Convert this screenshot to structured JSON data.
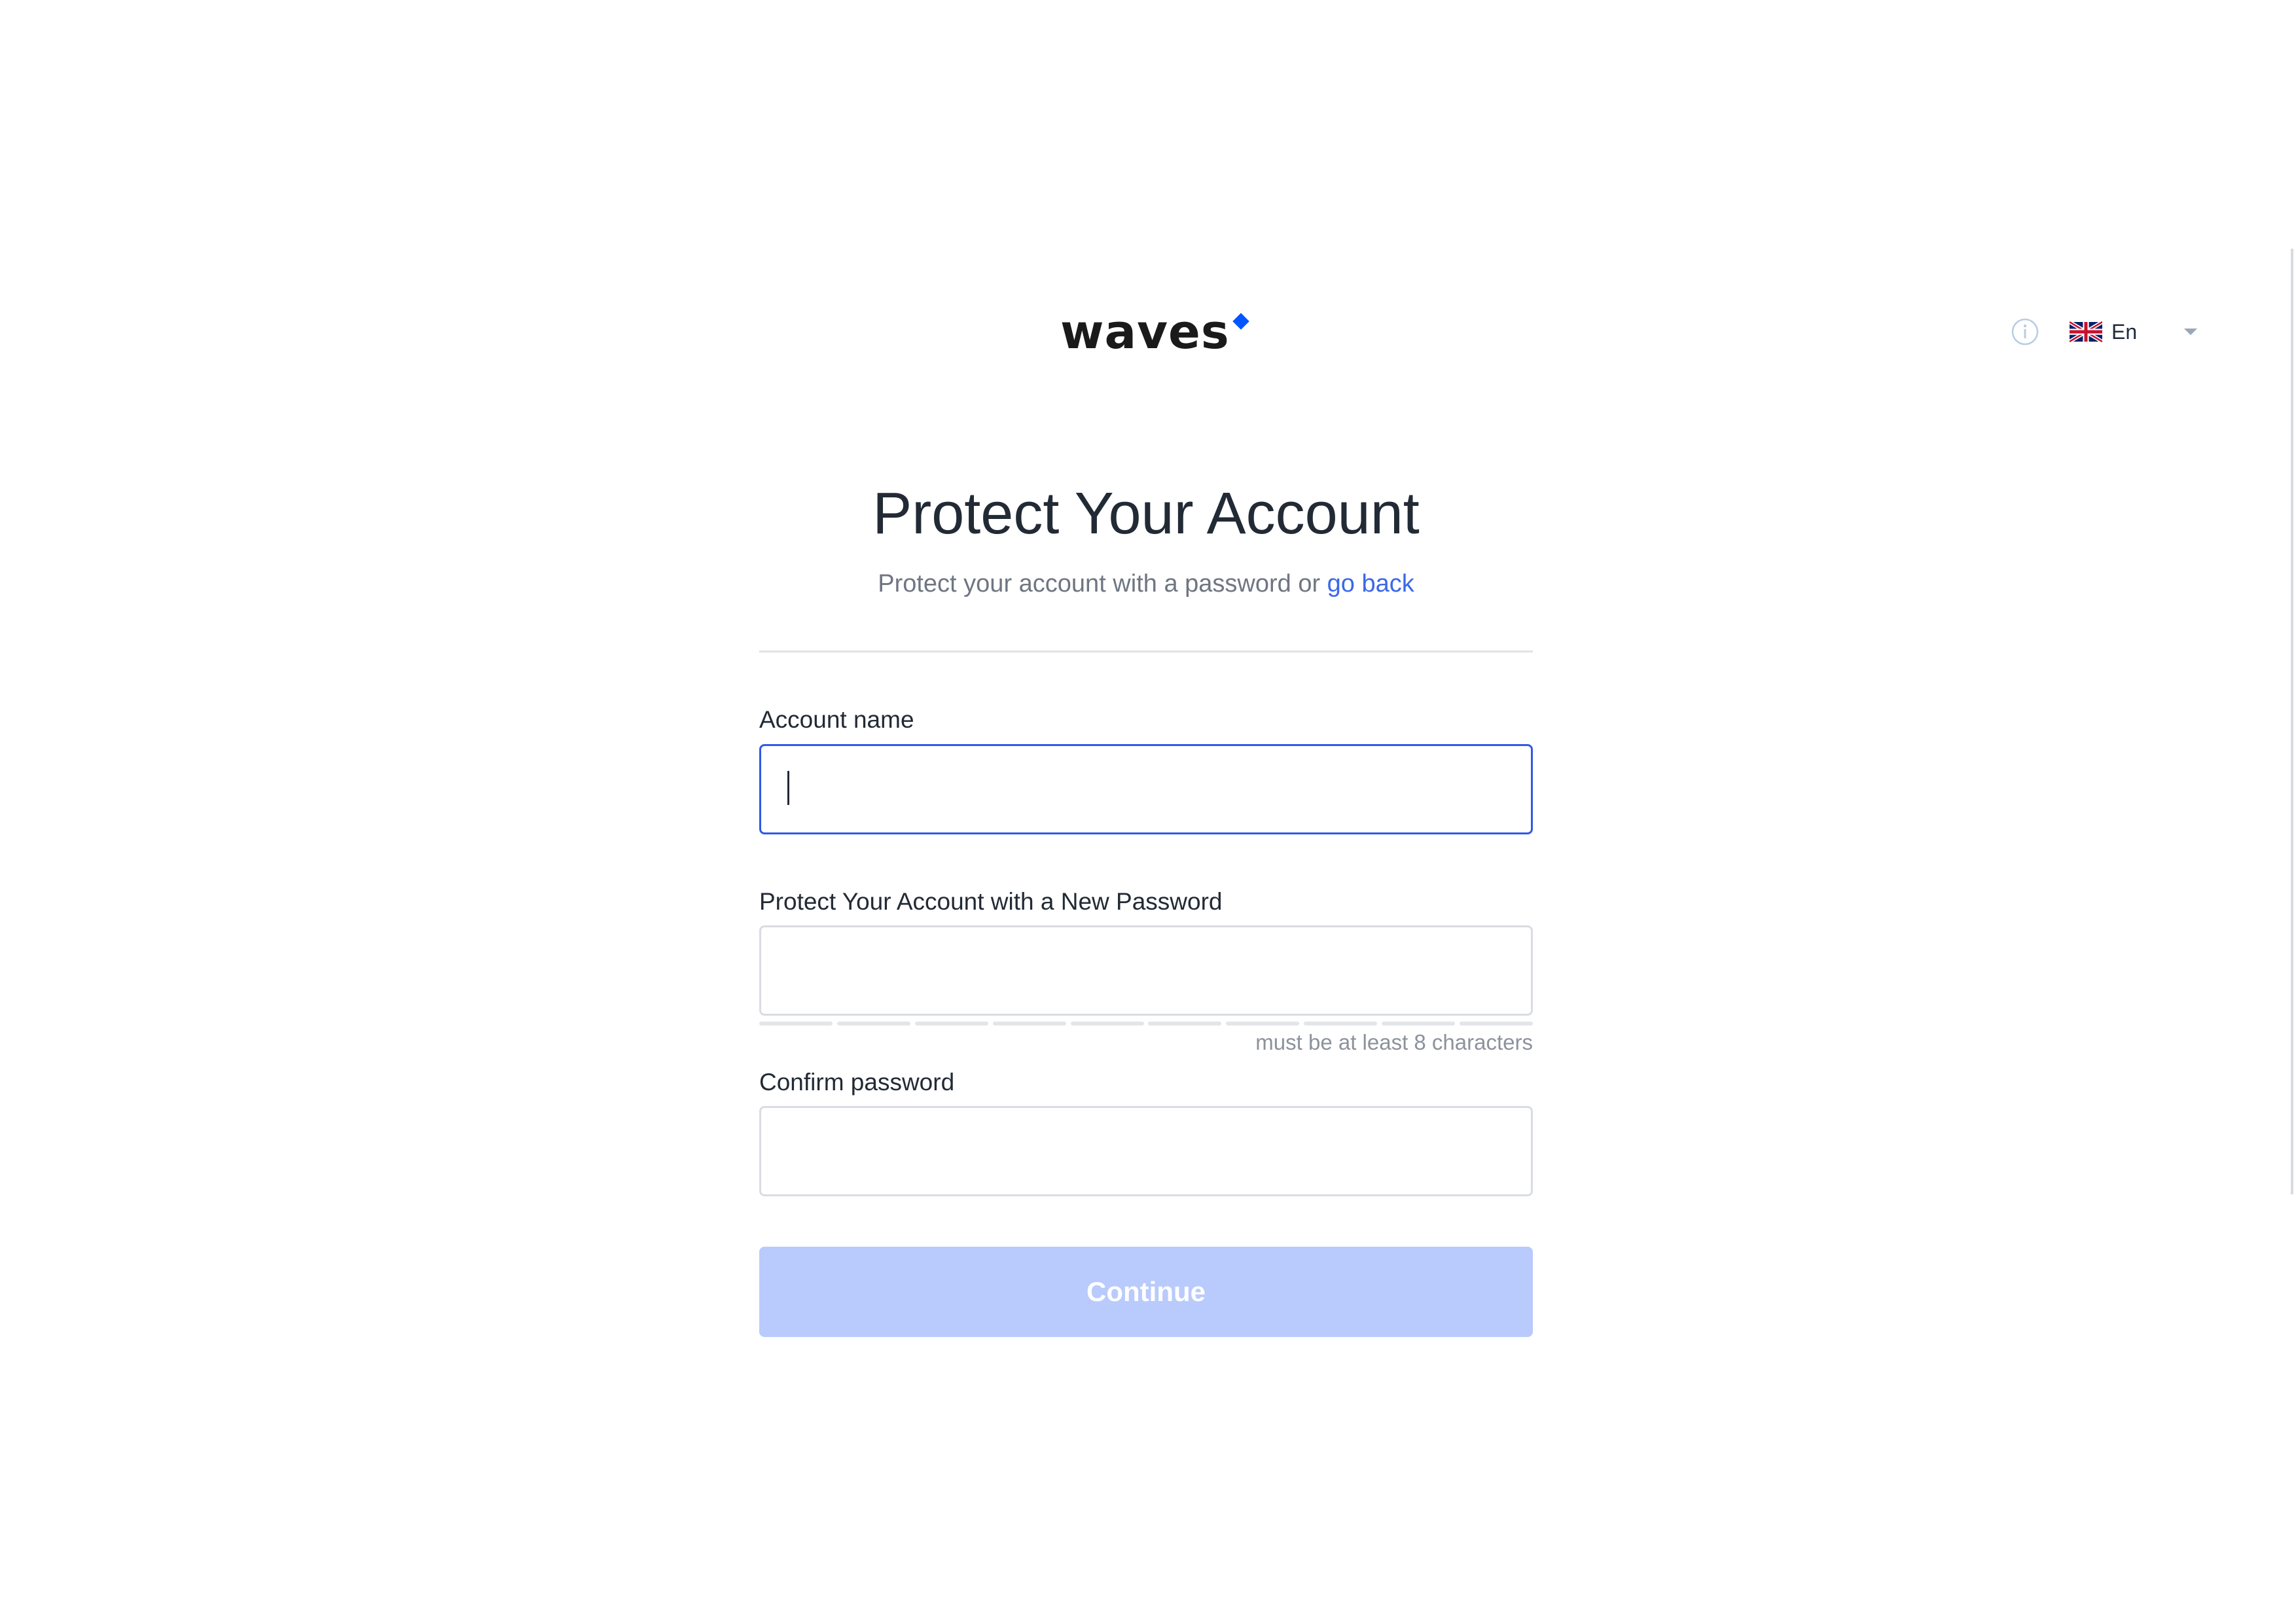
{
  "header": {
    "logo_text": "waves",
    "language": {
      "label": "En"
    },
    "brand_color": "#0055ff"
  },
  "main": {
    "title": "Protect Your Account",
    "subtitle": {
      "text": "Protect your account with a password or",
      "link": "go back"
    },
    "account_name": {
      "label": "Account name",
      "value": "",
      "placeholder": ""
    },
    "new_password": {
      "label": "Protect Your Account with a New Password",
      "value": "",
      "placeholder": "",
      "strength_segments": 10,
      "hint": "must be at least 8 characters"
    },
    "confirm_password": {
      "label": "Confirm password",
      "value": "",
      "placeholder": ""
    },
    "continue_label": "Continue"
  },
  "colors": {
    "accent": "#3159e6",
    "link": "#3b68e8",
    "button_disabled": "#b9cafc"
  }
}
